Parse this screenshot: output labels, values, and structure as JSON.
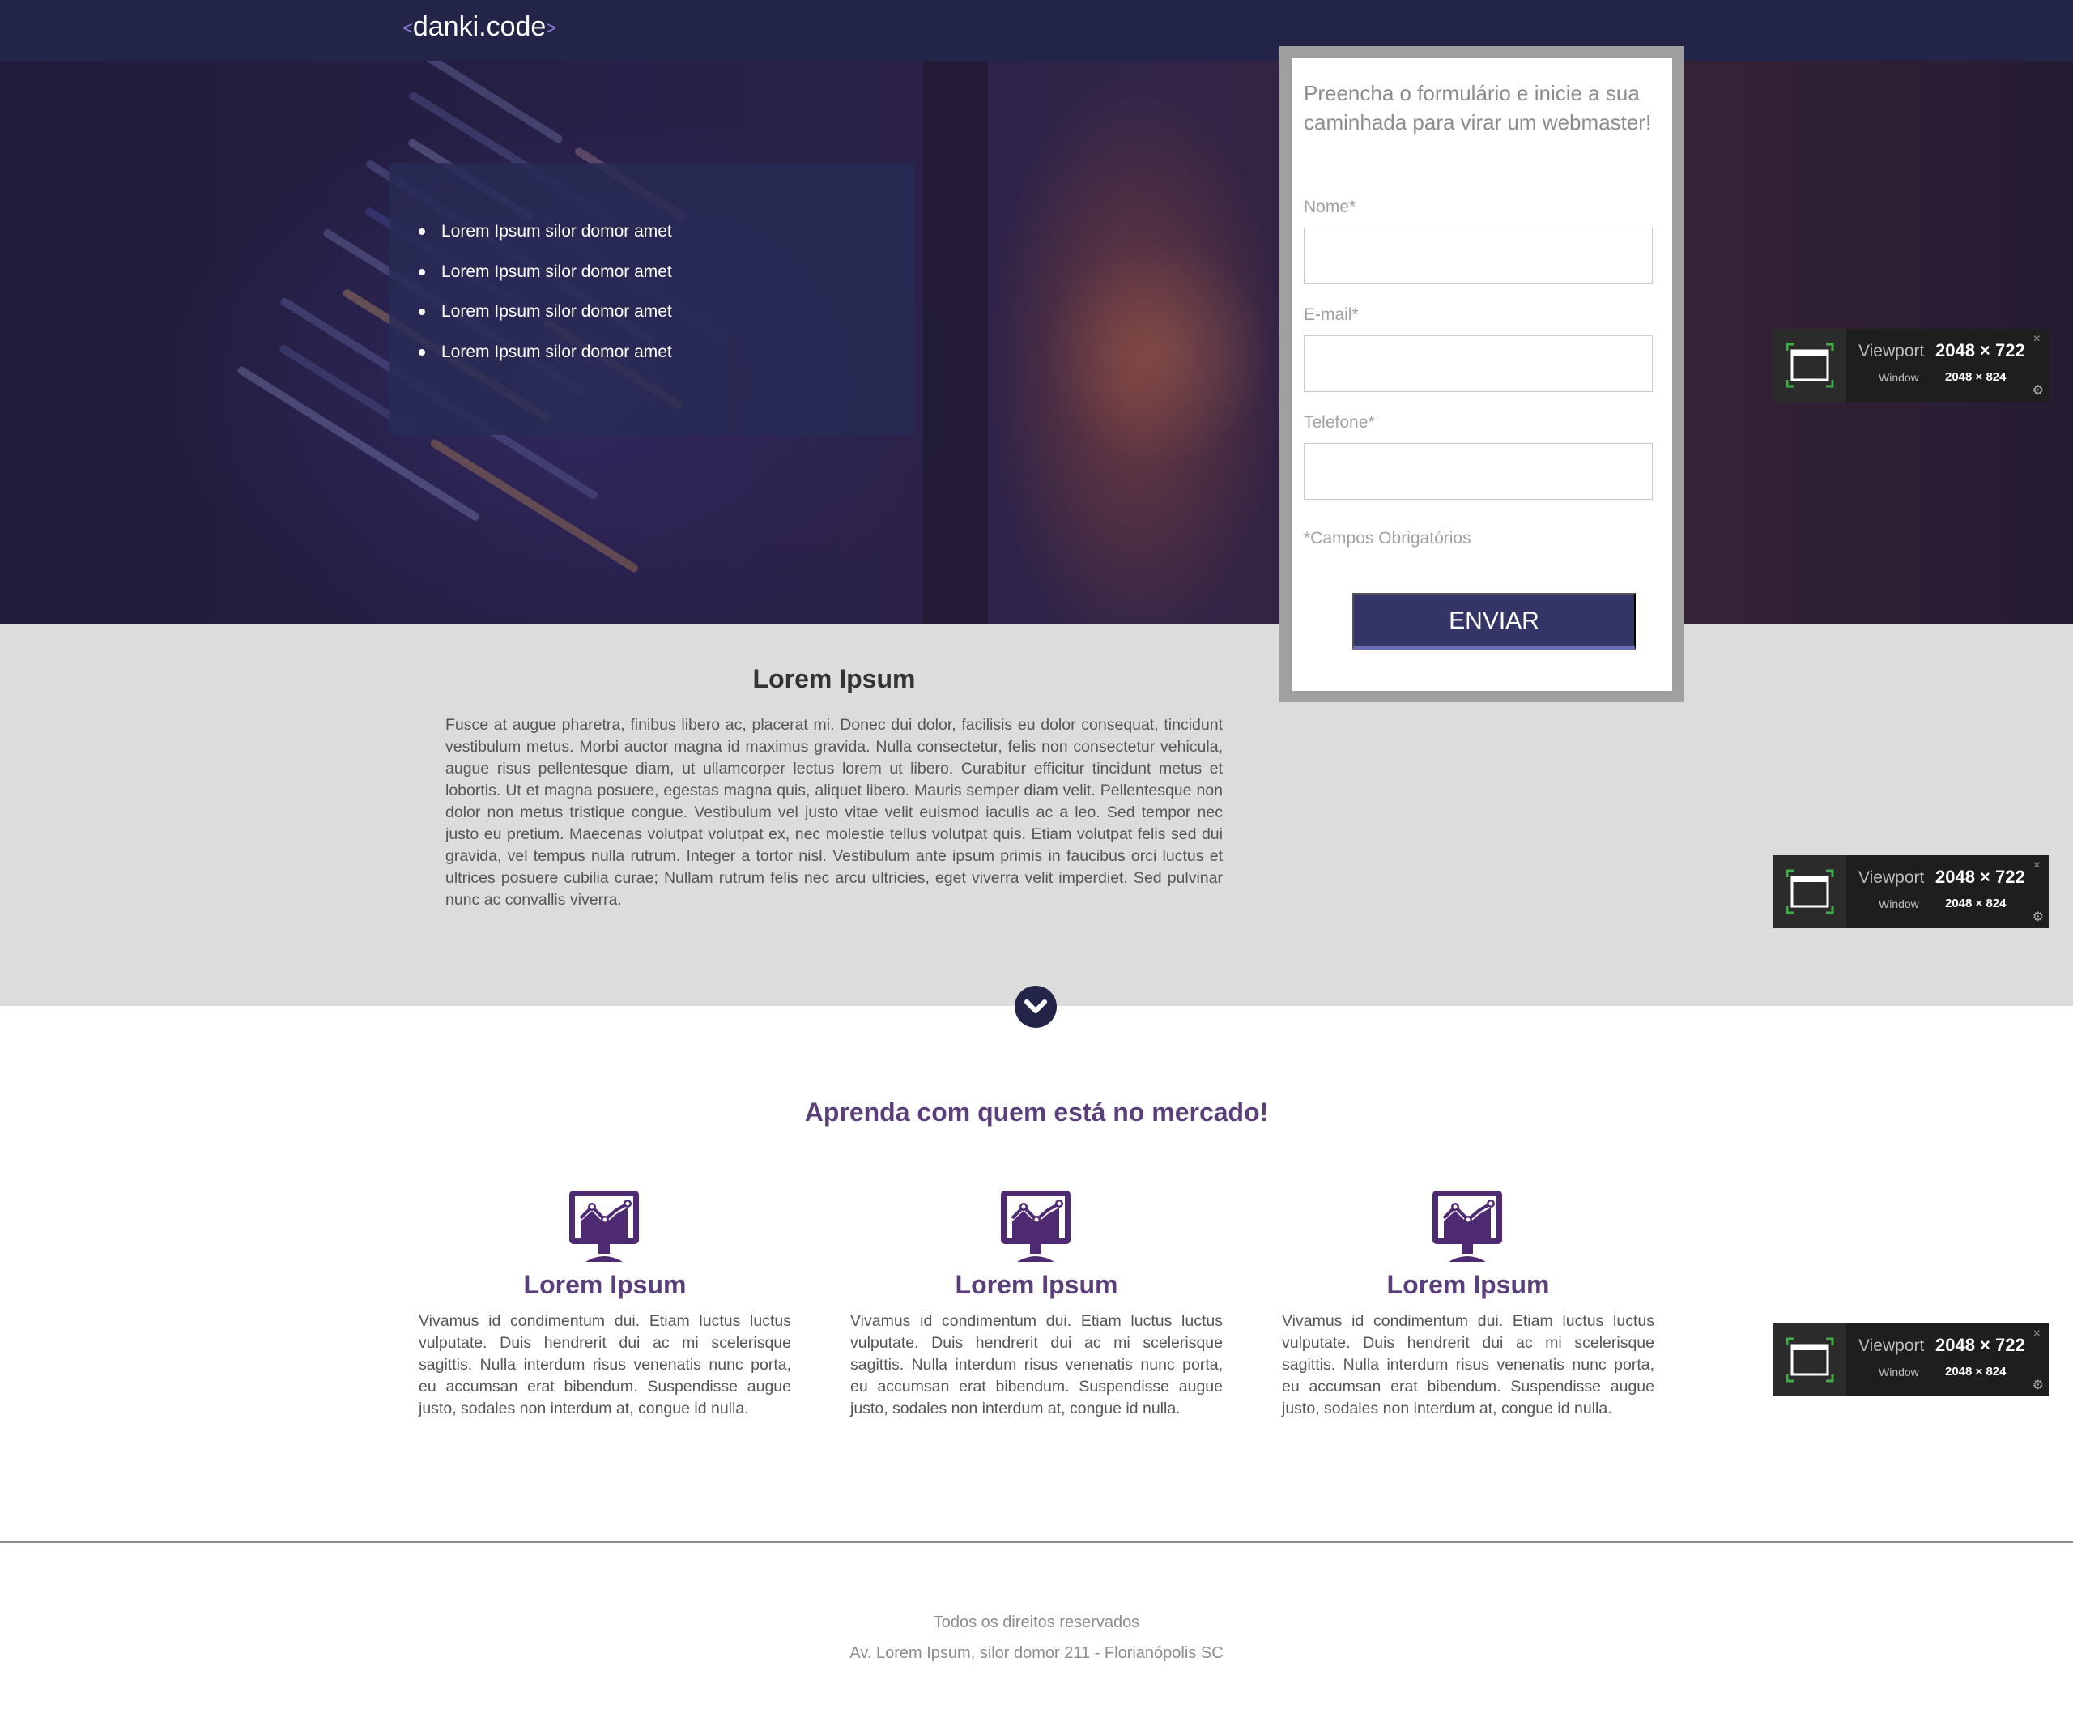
{
  "header": {
    "logo_left": "<",
    "logo_text": "danki.code",
    "logo_right": ">"
  },
  "hero": {
    "items": [
      "Lorem Ipsum silor domor amet",
      "Lorem Ipsum silor domor amet",
      "Lorem Ipsum silor domor amet",
      "Lorem Ipsum silor domor amet"
    ]
  },
  "form": {
    "intro": "Preencha o formulário e inicie a sua caminhada para virar um webmaster!",
    "fields": [
      {
        "label": "Nome*",
        "value": ""
      },
      {
        "label": "E-mail*",
        "value": ""
      },
      {
        "label": "Telefone*",
        "value": ""
      }
    ],
    "required_note": "*Campos Obrigatórios",
    "submit_label": "ENVIAR"
  },
  "about": {
    "title": "Lorem Ipsum",
    "text": "Fusce at augue pharetra, finibus libero ac, placerat mi. Donec dui dolor, facilisis eu dolor consequat, tincidunt vestibulum metus. Morbi auctor magna id maximus gravida. Nulla consectetur, felis non consectetur vehicula, augue risus pellentesque diam, ut ullamcorper lectus lorem ut libero. Curabitur efficitur tincidunt metus et lobortis. Ut et magna posuere, egestas magna quis, aliquet libero. Mauris semper diam velit. Pellentesque non dolor non metus tristique congue. Vestibulum vel justo vitae velit euismod iaculis ac a leo. Sed tempor nec justo eu pretium. Maecenas volutpat volutpat ex, nec molestie tellus volutpat quis. Etiam volutpat felis sed dui gravida, vel tempus nulla rutrum. Integer a tortor nisl. Vestibulum ante ipsum primis in faucibus orci luctus et ultrices posuere cubilia curae; Nullam rutrum felis nec arcu ultricies, eget viverra velit imperdiet. Sed pulvinar nunc ac convallis viverra."
  },
  "features": {
    "title": "Aprenda com quem está no mercado!",
    "items": [
      {
        "title": "Lorem Ipsum",
        "text": "Vivamus id condimentum dui. Etiam luctus luctus vulputate. Duis hendrerit dui ac mi scelerisque sagittis. Nulla interdum risus venenatis nunc porta, eu accumsan erat bibendum. Suspendisse augue justo, sodales non interdum at, congue id nulla."
      },
      {
        "title": "Lorem Ipsum",
        "text": "Vivamus id condimentum dui. Etiam luctus luctus vulputate. Duis hendrerit dui ac mi scelerisque sagittis. Nulla interdum risus venenatis nunc porta, eu accumsan erat bibendum. Suspendisse augue justo, sodales non interdum at, congue id nulla."
      },
      {
        "title": "Lorem Ipsum",
        "text": "Vivamus id condimentum dui. Etiam luctus luctus vulputate. Duis hendrerit dui ac mi scelerisque sagittis. Nulla interdum risus venenatis nunc porta, eu accumsan erat bibendum. Suspendisse augue justo, sodales non interdum at, congue id nulla."
      }
    ]
  },
  "footer": {
    "rights": "Todos os direitos reservados",
    "address": "Av. Lorem Ipsum, silor domor 211 - Florianópolis SC"
  },
  "viewport_widget": {
    "viewport_label": "Viewport",
    "viewport_value": "2048 × 722",
    "window_label": "Window",
    "window_value": "2048 × 824",
    "close_glyph": "×",
    "gear_glyph": "⚙"
  },
  "colors": {
    "header_bg": "#222548",
    "button_bg": "#343567",
    "accent_purple": "#5a3f7a",
    "section_gray": "#dcdcdc"
  },
  "icons": {
    "feature_icon": "monitor-chart-icon",
    "scroll_icon": "chevron-down-icon"
  }
}
